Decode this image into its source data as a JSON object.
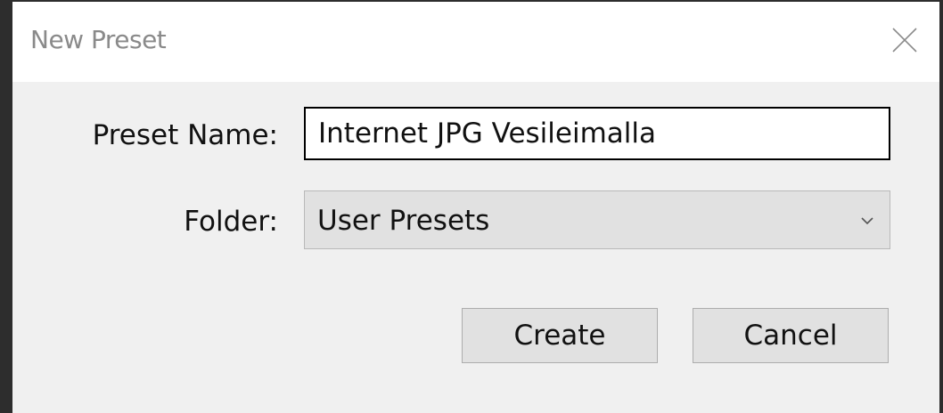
{
  "dialog": {
    "title": "New Preset",
    "close_icon": "close-icon"
  },
  "form": {
    "preset_name_label": "Preset Name:",
    "preset_name_value": "Internet JPG Vesileimalla",
    "folder_label": "Folder:",
    "folder_value": "User Presets",
    "folder_chevron_icon": "chevron-down-icon"
  },
  "actions": {
    "create_label": "Create",
    "cancel_label": "Cancel"
  }
}
